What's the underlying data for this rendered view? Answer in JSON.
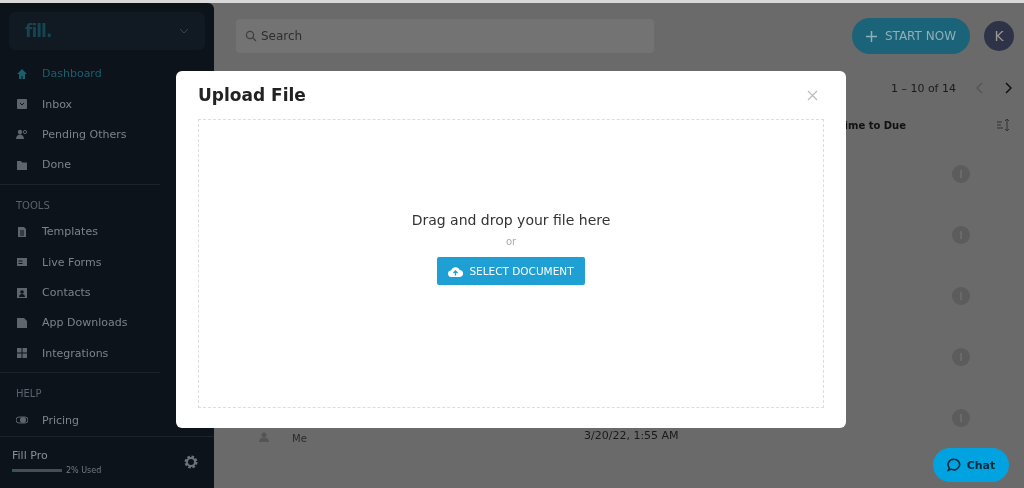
{
  "sidebar": {
    "logo": "fill.",
    "groups": [
      {
        "items": [
          {
            "label": "Dashboard",
            "kind": "home",
            "selected": true
          },
          {
            "label": "Inbox",
            "kind": "inbox",
            "selected": false
          },
          {
            "label": "Pending Others",
            "kind": "people",
            "selected": false
          },
          {
            "label": "Done",
            "kind": "folder",
            "selected": false
          }
        ]
      },
      {
        "heading": "TOOLS",
        "items": [
          {
            "label": "Templates",
            "kind": "doc",
            "selected": false
          },
          {
            "label": "Live Forms",
            "kind": "form",
            "selected": false
          },
          {
            "label": "Contacts",
            "kind": "contact",
            "selected": false
          },
          {
            "label": "App Downloads",
            "kind": "download",
            "selected": false
          },
          {
            "label": "Integrations",
            "kind": "grid",
            "selected": false
          }
        ]
      },
      {
        "heading": "HELP",
        "items": [
          {
            "label": "Pricing",
            "kind": "toggle",
            "selected": false
          }
        ]
      }
    ],
    "plan": {
      "name": "Fill Pro",
      "level": 0.02,
      "usage": "2% Used"
    }
  },
  "header": {
    "search": {
      "placeholder": "Search"
    },
    "start_button": "START NOW",
    "avatar": "K"
  },
  "pagination": {
    "range": "1 – 10 of 14"
  },
  "table": {
    "column": "ime to Due",
    "rows": [
      {},
      {},
      {},
      {},
      {
        "assignee": "Me",
        "date": "3/20/22, 1:55 AM"
      }
    ]
  },
  "modal": {
    "title": "Upload File",
    "drop_text": "Drag and drop your file here",
    "or": "or",
    "button": "SELECT DOCUMENT"
  },
  "chat_button": "Chat"
}
